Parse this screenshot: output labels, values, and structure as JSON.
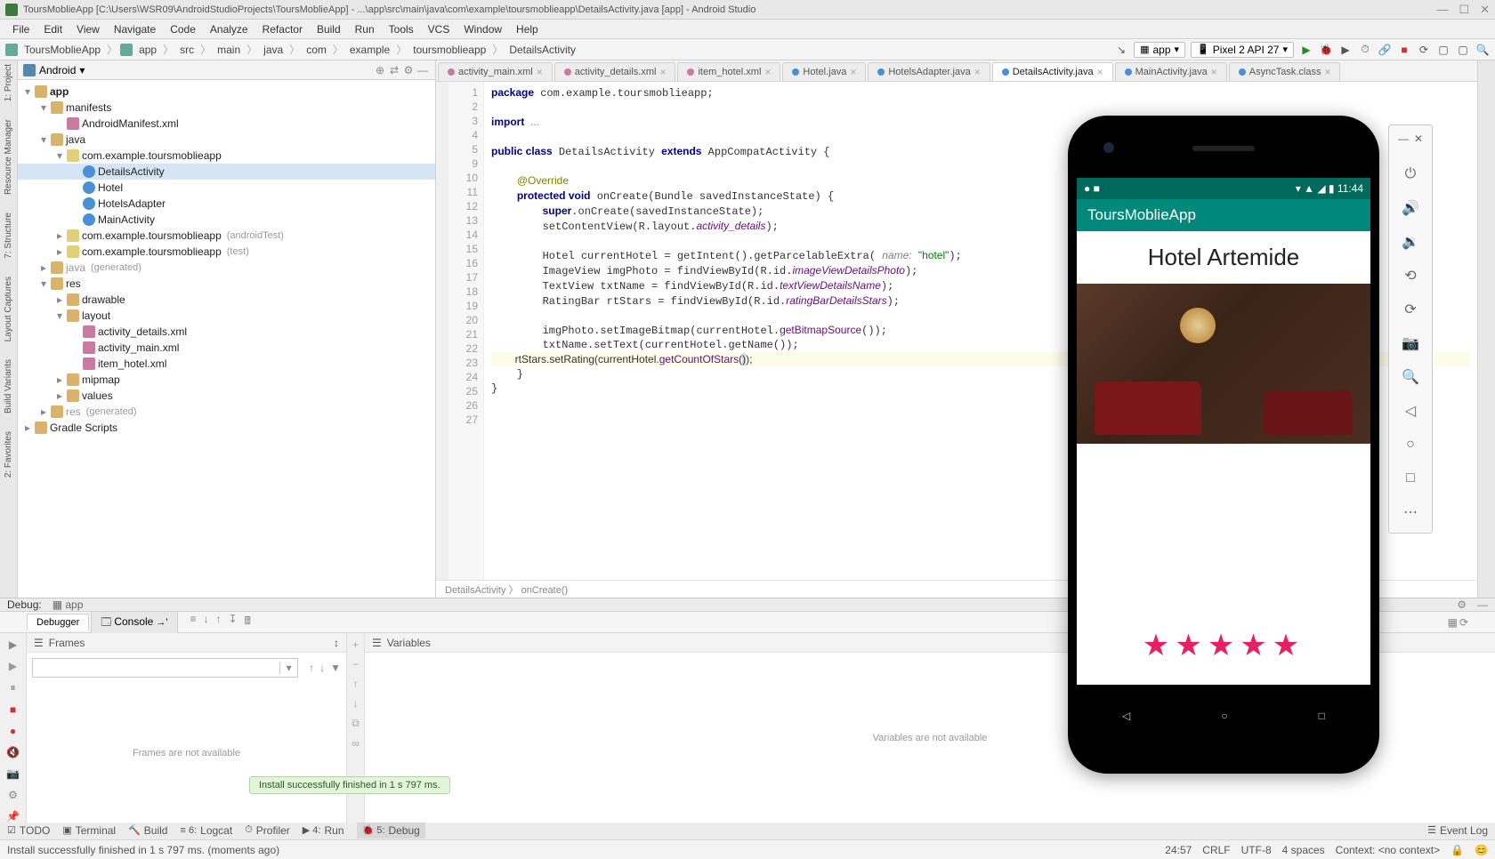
{
  "window": {
    "title": "ToursMoblieApp [C:\\Users\\WSR09\\AndroidStudioProjects\\ToursMoblieApp] - ...\\app\\src\\main\\java\\com\\example\\toursmoblieapp\\DetailsActivity.java [app] - Android Studio"
  },
  "menu": [
    "File",
    "Edit",
    "View",
    "Navigate",
    "Code",
    "Analyze",
    "Refactor",
    "Build",
    "Run",
    "Tools",
    "VCS",
    "Window",
    "Help"
  ],
  "breadcrumb": [
    "ToursMoblieApp",
    "app",
    "src",
    "main",
    "java",
    "com",
    "example",
    "toursmoblieapp",
    "DetailsActivity"
  ],
  "runConfig": {
    "module": "app",
    "device": "Pixel 2 API 27"
  },
  "projectView": {
    "mode": "Android",
    "root": "app",
    "nodes": [
      {
        "l": 1,
        "label": "manifests",
        "open": true
      },
      {
        "l": 2,
        "label": "AndroidManifest.xml",
        "icon": "xml"
      },
      {
        "l": 1,
        "label": "java",
        "open": true
      },
      {
        "l": 2,
        "label": "com.example.toursmoblieapp",
        "icon": "package",
        "open": true
      },
      {
        "l": 3,
        "label": "DetailsActivity",
        "icon": "class",
        "selected": true
      },
      {
        "l": 3,
        "label": "Hotel",
        "icon": "class"
      },
      {
        "l": 3,
        "label": "HotelsAdapter",
        "icon": "class"
      },
      {
        "l": 3,
        "label": "MainActivity",
        "icon": "class"
      },
      {
        "l": 2,
        "label": "com.example.toursmoblieapp",
        "hint": "(androidTest)",
        "icon": "package"
      },
      {
        "l": 2,
        "label": "com.example.toursmoblieapp",
        "hint": "(test)",
        "icon": "package"
      },
      {
        "l": 1,
        "label": "java",
        "hint": "(generated)",
        "dim": true
      },
      {
        "l": 1,
        "label": "res",
        "open": true
      },
      {
        "l": 2,
        "label": "drawable"
      },
      {
        "l": 2,
        "label": "layout",
        "open": true
      },
      {
        "l": 3,
        "label": "activity_details.xml",
        "icon": "xml"
      },
      {
        "l": 3,
        "label": "activity_main.xml",
        "icon": "xml"
      },
      {
        "l": 3,
        "label": "item_hotel.xml",
        "icon": "xml"
      },
      {
        "l": 2,
        "label": "mipmap"
      },
      {
        "l": 2,
        "label": "values"
      },
      {
        "l": 1,
        "label": "res",
        "hint": "(generated)",
        "dim": true
      }
    ],
    "gradle": "Gradle Scripts"
  },
  "editor": {
    "tabs": [
      {
        "label": "activity_main.xml",
        "type": "xml"
      },
      {
        "label": "activity_details.xml",
        "type": "xml"
      },
      {
        "label": "item_hotel.xml",
        "type": "xml"
      },
      {
        "label": "Hotel.java",
        "type": "java"
      },
      {
        "label": "HotelsAdapter.java",
        "type": "java"
      },
      {
        "label": "DetailsActivity.java",
        "type": "java",
        "active": true
      },
      {
        "label": "MainActivity.java",
        "type": "java"
      },
      {
        "label": "AsyncTask.class",
        "type": "java"
      }
    ],
    "lines": [
      1,
      2,
      3,
      4,
      5,
      9,
      10,
      11,
      12,
      13,
      14,
      15,
      16,
      17,
      18,
      19,
      20,
      21,
      22,
      23,
      24,
      25,
      26,
      27
    ],
    "breadcrumb": "DetailsActivity 〉 onCreate()"
  },
  "code": {
    "pkg": "package com.example.toursmoblieapp;",
    "imp": "import ...",
    "cls": "public class DetailsActivity extends AppCompatActivity {",
    "ann": "@Override",
    "mtd": "protected void onCreate(Bundle savedInstanceState) {",
    "l1": "super.onCreate(savedInstanceState);",
    "l2": "setContentView(R.layout.activity_details);",
    "l3": "Hotel currentHotel = getIntent().getParcelableExtra( name: \"hotel\");",
    "l4": "ImageView imgPhoto = findViewById(R.id.imageViewDetailsPhoto);",
    "l5": "TextView txtName = findViewById(R.id.textViewDetailsName);",
    "l6": "RatingBar rtStars = findViewById(R.id.ratingBarDetailsStars);",
    "l7": "imgPhoto.setImageBitmap(currentHotel.getBitmapSource());",
    "l8": "txtName.setText(currentHotel.getName());",
    "l9": "rtStars.setRating(currentHotel.getCountOfStars());"
  },
  "emulator": {
    "statusTime": "11:44",
    "appName": "ToursMoblieApp",
    "hotelName": "Hotel Artemide",
    "stars": "★★★★★"
  },
  "debug": {
    "title": "Debug:",
    "target": "app",
    "tabs": [
      "Debugger",
      "Console"
    ],
    "frames": {
      "title": "Frames",
      "msg": "Frames are not available"
    },
    "vars": {
      "title": "Variables",
      "msg": "Variables are not available"
    }
  },
  "toast": "Install successfully finished in 1 s 797 ms.",
  "bottomTools": [
    "TODO",
    "Terminal",
    "Build",
    "Logcat",
    "Profiler",
    "Run",
    "Debug"
  ],
  "bottomRight": "Event Log",
  "status": {
    "msg": "Install successfully finished in 1 s 797 ms. (moments ago)",
    "pos": "24:57",
    "eol": "CRLF",
    "enc": "UTF-8",
    "indent": "4 spaces",
    "ctx": "Context: <no context>"
  }
}
